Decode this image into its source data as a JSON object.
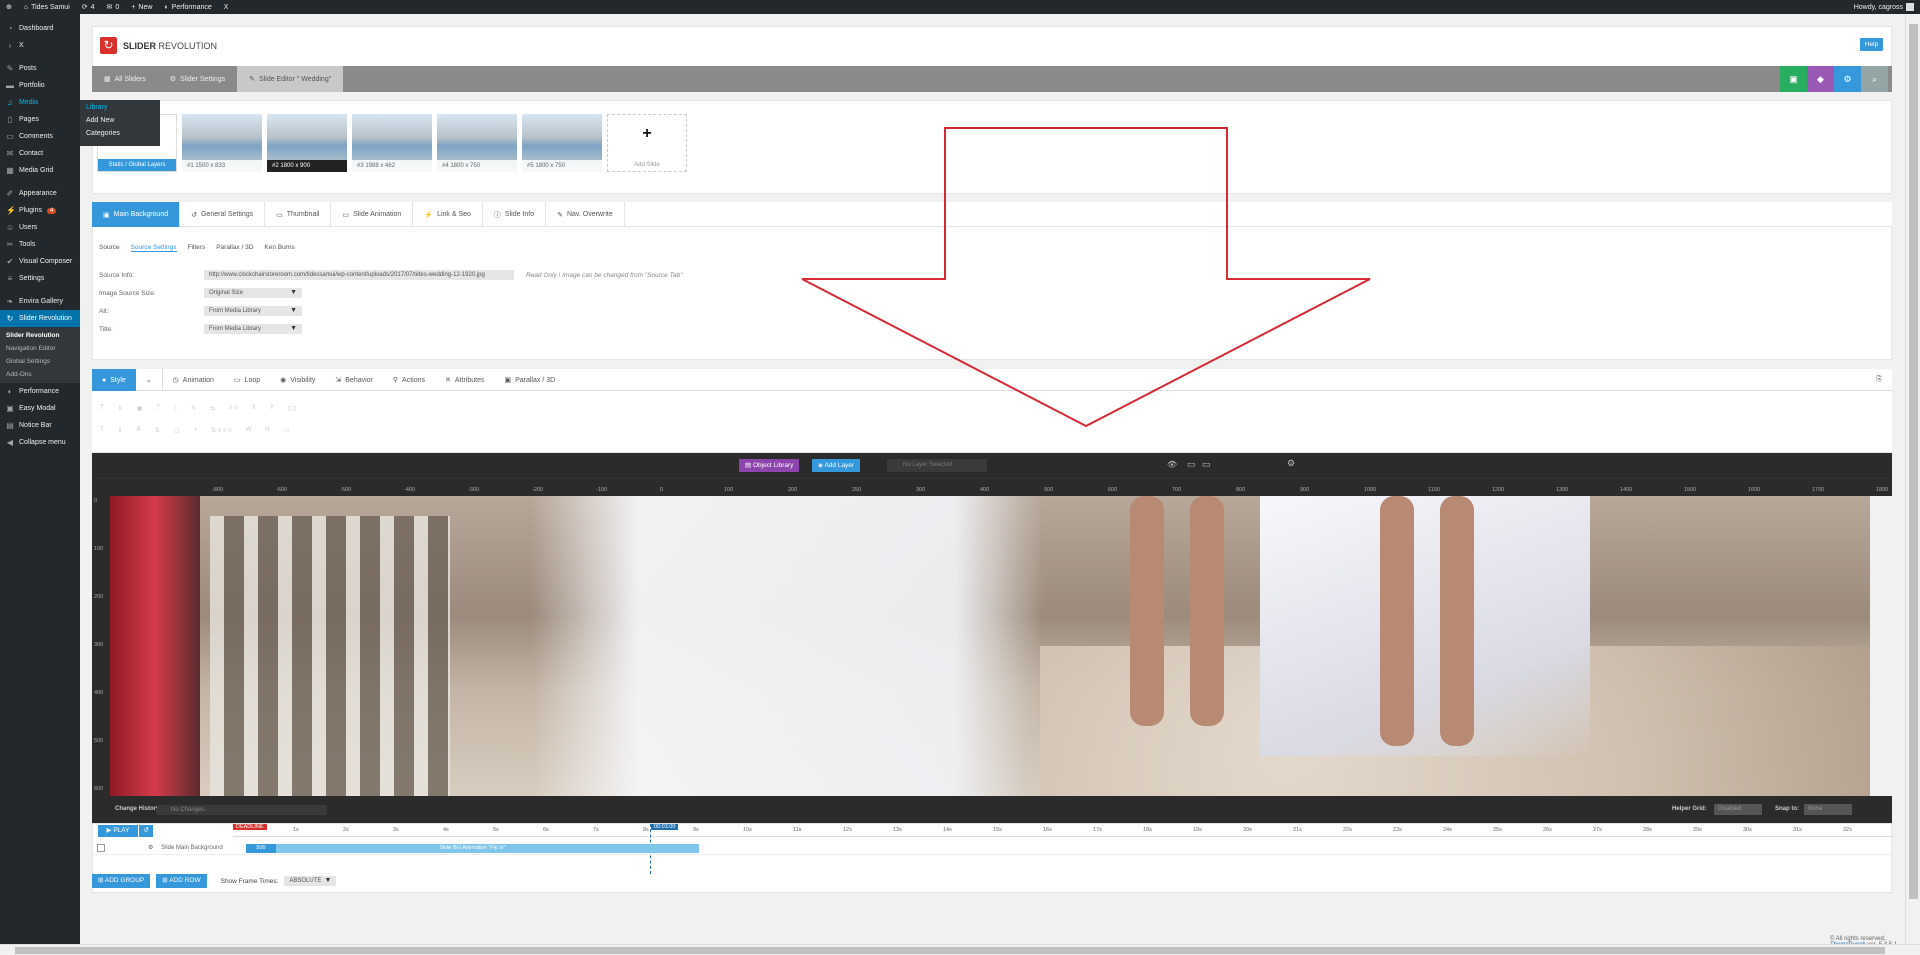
{
  "adminbar": {
    "site": "Tides Samui",
    "updates": "4",
    "comments": "0",
    "new": "New",
    "performance": "Performance",
    "x": "X",
    "howdy": "Howdy, cagross"
  },
  "sidebar": {
    "items": [
      {
        "id": "dashboard",
        "label": "Dashboard",
        "icon": "dashboard-icon"
      },
      {
        "id": "x",
        "label": "X",
        "icon": "chevron-right-icon"
      },
      {
        "id": "posts",
        "label": "Posts",
        "icon": "pin-icon"
      },
      {
        "id": "portfolio",
        "label": "Portfolio",
        "icon": "folder-icon"
      },
      {
        "id": "media",
        "label": "Media",
        "icon": "media-icon"
      },
      {
        "id": "pages",
        "label": "Pages",
        "icon": "page-icon"
      },
      {
        "id": "comments",
        "label": "Comments",
        "icon": "comment-icon"
      },
      {
        "id": "contact",
        "label": "Contact",
        "icon": "mail-icon"
      },
      {
        "id": "media-grid",
        "label": "Media Grid",
        "icon": "grid-icon"
      },
      {
        "id": "appearance",
        "label": "Appearance",
        "icon": "brush-icon"
      },
      {
        "id": "plugins",
        "label": "Plugins",
        "icon": "plug-icon",
        "badge": "4"
      },
      {
        "id": "users",
        "label": "Users",
        "icon": "user-icon"
      },
      {
        "id": "tools",
        "label": "Tools",
        "icon": "wrench-icon"
      },
      {
        "id": "visual-composer",
        "label": "Visual Composer",
        "icon": "vc-icon"
      },
      {
        "id": "settings",
        "label": "Settings",
        "icon": "settings-icon"
      },
      {
        "id": "envira",
        "label": "Envira Gallery",
        "icon": "leaf-icon"
      },
      {
        "id": "slider-revolution",
        "label": "Slider Revolution",
        "icon": "refresh-icon"
      }
    ],
    "slider_sub": [
      "Slider Revolution",
      "Navigation Editor",
      "Global Settings",
      "Add-Ons"
    ],
    "items2": [
      {
        "id": "performance",
        "label": "Performance",
        "icon": "performance-icon"
      },
      {
        "id": "easy-modal",
        "label": "Easy Modal",
        "icon": "modal-icon"
      },
      {
        "id": "notice-bar",
        "label": "Notice Bar",
        "icon": "notice-icon"
      },
      {
        "id": "collapse",
        "label": "Collapse menu",
        "icon": "collapse-icon"
      }
    ]
  },
  "flyout": [
    "Library",
    "Add New",
    "Categories"
  ],
  "header": {
    "brand_bold": "SLIDER",
    "brand_light": " REVOLUTION",
    "help": "Help"
  },
  "tabs": [
    "All Sliders",
    "Slider Settings",
    "Slide Editor \" Wedding\""
  ],
  "slides": [
    {
      "label": "Static / Global Layers"
    },
    {
      "label": "#1 1500 x 833"
    },
    {
      "label": "#2 1800 x 900"
    },
    {
      "label": "#3 1988 x 462"
    },
    {
      "label": "#4 1800 x 750"
    },
    {
      "label": "#5 1800 x 750"
    },
    {
      "label": "Add Slide"
    }
  ],
  "bgtabs": [
    "Main Background",
    "General Settings",
    "Thumbnail",
    "Slide Animation",
    "Link & Seo",
    "Slide Info",
    "Nav. Overwrite"
  ],
  "subtabs": [
    "Source",
    "Source Settings",
    "Filters",
    "Parallax / 3D",
    "Ken Burns"
  ],
  "form": {
    "source_info_label": "Source Info:",
    "source_info": "http://www.clockchairstoreroom.com/tidessamui/wp-content/uploads/2017/07/tides-wedding-12-1920.jpg",
    "readonly": "Read Only ! Image can be changed from \"Source Tab\"",
    "size_label": "Image Source Size:",
    "size": "Original Size",
    "alt_label": "Alt:",
    "alt": "From Media Library",
    "title_label": "Title:",
    "title": "From Media Library"
  },
  "layertabs": [
    "Style",
    "Animation",
    "Loop",
    "Visibility",
    "Behavior",
    "Actions",
    "Attributes",
    "Parallax / 3D"
  ],
  "canvas": {
    "object_library": "Object Library",
    "add_layer": "Add Layer",
    "no_layer": "No Layer Selected"
  },
  "ruler_ticks": [
    "-800",
    "-600",
    "-500",
    "-400",
    "-300",
    "-200",
    "-100",
    "0",
    "100",
    "200",
    "250",
    "300",
    "400",
    "500",
    "600",
    "700",
    "800",
    "900",
    "1000",
    "1100",
    "1200",
    "1300",
    "1400",
    "1500",
    "1600",
    "1700",
    "1800"
  ],
  "vruler_ticks": [
    "0",
    "100",
    "200",
    "300",
    "400",
    "500",
    "600"
  ],
  "history": {
    "label": "Change History:",
    "value": "No Changes.",
    "helper_grid": "Helper Grid:",
    "helper_val": "Disabled",
    "snap": "Snap to:",
    "snap_val": "None"
  },
  "timeline": {
    "play": "PLAY",
    "deadline": "DEADLINE",
    "time": "00:03.00",
    "ticks": [
      "1s",
      "2s",
      "3s",
      "4s",
      "5s",
      "6s",
      "7s",
      "8s",
      "9s",
      "10s",
      "11s",
      "12s",
      "13s",
      "14s",
      "15s",
      "16s",
      "17s",
      "18s",
      "19s",
      "20s",
      "21s",
      "22s",
      "23s",
      "24s",
      "25s",
      "26s",
      "27s",
      "28s",
      "29s",
      "30s",
      "31s",
      "32s"
    ],
    "track_label": "Slide Main Background",
    "bar_start": "500",
    "bar_label": "Slide BG Animation \"Fly In\""
  },
  "bottom": {
    "add_group": "ADD GROUP",
    "add_row": "ADD ROW",
    "show_frame": "Show Frame Times:",
    "frame_val": "ABSOLUTE"
  },
  "footer": {
    "text": "© All rights reserved,",
    "link": "ThemePunch",
    "ver": " ver. 5.4.5.1"
  },
  "colors": {
    "accent": "#3498db",
    "purple": "#8e44ad",
    "arrow": "#d42a34",
    "wp_dark": "#23282d"
  }
}
